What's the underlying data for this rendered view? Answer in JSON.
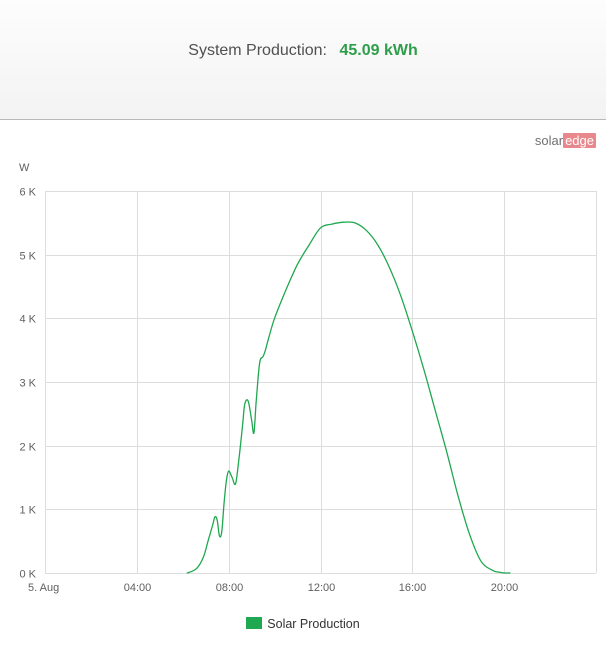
{
  "header": {
    "label": "System Production:",
    "value": "45.09 kWh"
  },
  "logo": {
    "part1": "solar",
    "part2": "edge"
  },
  "legend": {
    "label": "Solar Production"
  },
  "colors": {
    "series": "#1fa84f",
    "value_text": "#2e9e4a",
    "grid": "#dddddd",
    "axis_text": "#606060"
  },
  "chart_data": {
    "type": "line",
    "ylabel": "W",
    "x_ticks": [
      "5. Aug",
      "04:00",
      "08:00",
      "12:00",
      "16:00",
      "20:00"
    ],
    "x_tick_hours": [
      0,
      4,
      8,
      12,
      16,
      20
    ],
    "xlim_hours": [
      0,
      24
    ],
    "y_ticks": [
      "0 K",
      "1 K",
      "2 K",
      "3 K",
      "4 K",
      "5 K",
      "6 K"
    ],
    "y_tick_values": [
      0,
      1000,
      2000,
      3000,
      4000,
      5000,
      6000
    ],
    "ylim": [
      0,
      6000
    ],
    "grid": true,
    "legend_position": "bottom-center",
    "series": [
      {
        "name": "Solar Production",
        "x_hours": [
          6.2,
          6.6,
          6.9,
          7.1,
          7.3,
          7.4,
          7.5,
          7.6,
          7.7,
          7.8,
          7.9,
          8.0,
          8.15,
          8.3,
          8.45,
          8.6,
          8.7,
          8.85,
          9.0,
          9.1,
          9.2,
          9.35,
          9.5,
          9.6,
          9.75,
          10.0,
          10.5,
          11.0,
          11.5,
          12.0,
          12.5,
          13.0,
          13.5,
          14.0,
          14.5,
          15.0,
          15.5,
          16.0,
          16.5,
          17.0,
          17.5,
          18.0,
          18.5,
          19.0,
          19.5,
          19.75,
          20.0,
          20.25
        ],
        "values": [
          0,
          70,
          250,
          500,
          750,
          880,
          830,
          580,
          650,
          1100,
          1450,
          1600,
          1500,
          1400,
          1800,
          2300,
          2650,
          2700,
          2400,
          2200,
          2700,
          3300,
          3400,
          3500,
          3700,
          4000,
          4450,
          4850,
          5150,
          5420,
          5480,
          5510,
          5500,
          5380,
          5150,
          4800,
          4350,
          3800,
          3200,
          2550,
          1900,
          1200,
          600,
          180,
          40,
          15,
          0,
          0
        ]
      }
    ]
  }
}
